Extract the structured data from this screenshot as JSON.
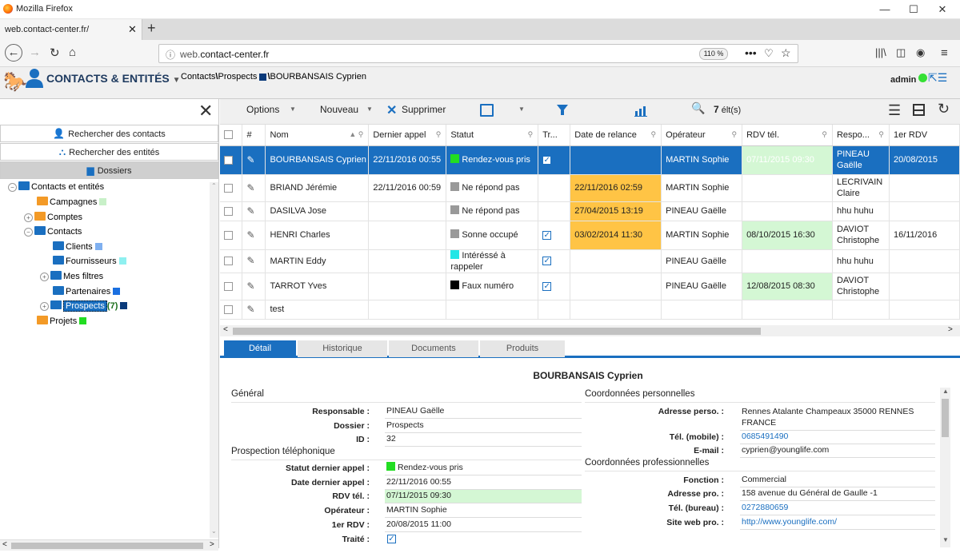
{
  "browser": {
    "title": "Mozilla Firefox",
    "tab_title": "web.contact-center.fr/",
    "url_prefix": "web.",
    "url_domain": "contact-center.fr",
    "zoom": "110 %"
  },
  "app": {
    "title": "CONTACTS & ENTITÉS",
    "breadcrumb_a": "Contacts",
    "breadcrumb_b": "Prospects",
    "breadcrumb_c": "BOURBANSAIS Cyprien",
    "user": "admin"
  },
  "left": {
    "search_contacts": "Rechercher des contacts",
    "search_entities": "Rechercher des entités",
    "dossiers": "Dossiers",
    "tree": {
      "root": "Contacts et entités",
      "campagnes": "Campagnes",
      "comptes": "Comptes",
      "contacts": "Contacts",
      "clients": "Clients",
      "fournisseurs": "Fournisseurs",
      "mes_filtres": "Mes filtres",
      "partenaires": "Partenaires",
      "prospects": "Prospects",
      "prospects_count": "(7)",
      "projets": "Projets"
    },
    "colors": {
      "campagnes": "#c8f0c8",
      "clients": "#7fb0f0",
      "fournisseurs": "#8ff0f0",
      "partenaires": "#1a6fe0",
      "prospects": "#0a3a7a",
      "projets": "#22dd22"
    }
  },
  "toolbar": {
    "options": "Options",
    "nouveau": "Nouveau",
    "supprimer": "Supprimer",
    "count": "7",
    "count_unit": "élt(s)"
  },
  "grid": {
    "headers": {
      "num": "#",
      "nom": "Nom",
      "dernier": "Dernier appel",
      "statut": "Statut",
      "traite": "Tr...",
      "relance": "Date de relance",
      "operateur": "Opérateur",
      "rdv": "RDV tél.",
      "respo": "Respo...",
      "premier": "1er RDV"
    },
    "rows": [
      {
        "nom": "BOURBANSAIS Cyprien",
        "dernier": "22/11/2016 00:55",
        "statut": "Rendez-vous pris",
        "color": "#22dd22",
        "traite": true,
        "relance": "",
        "operateur": "MARTIN Sophie",
        "rdv": "07/11/2015 09:30",
        "respo": "PINEAU\nGaëlle",
        "premier": "20/08/2015"
      },
      {
        "nom": "BRIAND Jérémie",
        "dernier": "22/11/2016 00:59",
        "statut": "Ne répond pas",
        "color": "#999999",
        "traite": false,
        "relance": "22/11/2016 02:59",
        "operateur": "MARTIN Sophie",
        "rdv": "",
        "respo": "LECRIVAIN\nClaire",
        "premier": ""
      },
      {
        "nom": "DASILVA Jose",
        "dernier": "",
        "statut": "Ne répond pas",
        "color": "#999999",
        "traite": false,
        "relance": "27/04/2015 13:19",
        "operateur": "PINEAU Gaëlle",
        "rdv": "",
        "respo": "hhu huhu",
        "premier": ""
      },
      {
        "nom": "HENRI Charles",
        "dernier": "",
        "statut": "Sonne occupé",
        "color": "#999999",
        "traite": true,
        "relance": "03/02/2014 11:30",
        "operateur": "MARTIN Sophie",
        "rdv": "08/10/2015 16:30",
        "respo": "DAVIOT\nChristophe",
        "premier": "16/11/2016"
      },
      {
        "nom": "MARTIN Eddy",
        "dernier": "",
        "statut": "Intéréssé à rappeler",
        "color": "#22e6e6",
        "traite": true,
        "relance": "",
        "operateur": "PINEAU Gaëlle",
        "rdv": "",
        "respo": "hhu huhu",
        "premier": ""
      },
      {
        "nom": "TARROT Yves",
        "dernier": "",
        "statut": "Faux numéro",
        "color": "#000000",
        "traite": true,
        "relance": "",
        "operateur": "PINEAU Gaëlle",
        "rdv": "12/08/2015 08:30",
        "respo": "DAVIOT\nChristophe",
        "premier": ""
      },
      {
        "nom": "test",
        "dernier": "",
        "statut": "",
        "color": "",
        "traite": false,
        "relance": "",
        "operateur": "",
        "rdv": "",
        "respo": "",
        "premier": ""
      }
    ]
  },
  "tabs": [
    "Détail",
    "Historique",
    "Documents",
    "Produits"
  ],
  "detail": {
    "name": "BOURBANSAIS Cyprien",
    "general": "Général",
    "responsable_l": "Responsable :",
    "responsable": "PINEAU Gaëlle",
    "dossier_l": "Dossier :",
    "dossier": "Prospects",
    "id_l": "ID :",
    "id": "32",
    "prospection": "Prospection téléphonique",
    "statut_l": "Statut dernier appel :",
    "statut": "Rendez-vous pris",
    "date_l": "Date dernier appel :",
    "date": "22/11/2016 00:55",
    "rdv_l": "RDV tél. :",
    "rdv": "07/11/2015 09:30",
    "operateur_l": "Opérateur :",
    "operateur": "MARTIN Sophie",
    "premier_l": "1er RDV :",
    "premier": "20/08/2015 11:00",
    "traite_l": "Traité :",
    "perso": "Coordonnées personnelles",
    "adresse_l": "Adresse perso. :",
    "adresse": "Rennes Atalante Champeaux 35000 RENNES FRANCE",
    "mobile_l": "Tél. (mobile) :",
    "mobile": "0685491490",
    "email_l": "E-mail :",
    "email": "cyprien@younglife.com",
    "pro": "Coordonnées professionnelles",
    "fonction_l": "Fonction :",
    "fonction": "Commercial",
    "adrpro_l": "Adresse pro. :",
    "adrpro": "158 avenue du Général de Gaulle -1",
    "bureau_l": "Tél. (bureau) :",
    "bureau": "0272880659",
    "web_l": "Site web pro. :",
    "web": "http://www.younglife.com/"
  }
}
